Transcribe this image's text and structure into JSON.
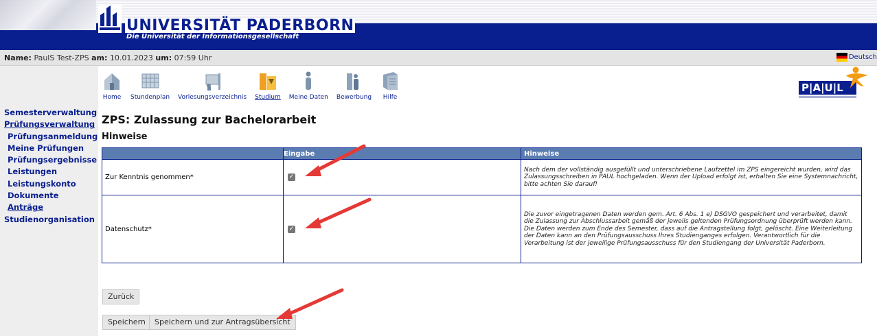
{
  "header": {
    "university": "UNIVERSITÄT PADERBORN",
    "subtitle": "Die Universität der Informationsgesellschaft"
  },
  "infobar": {
    "name_label": "Name:",
    "name_value": "PaulS Test-ZPS",
    "date_label": "am:",
    "date_value": "10.01.2023",
    "time_label": "um:",
    "time_value": "07:59 Uhr",
    "language": "Deutsch"
  },
  "topnav": [
    {
      "label": "Home",
      "icon": "home-icon"
    },
    {
      "label": "Stundenplan",
      "icon": "calendar-icon"
    },
    {
      "label": "Vorlesungsverzeichnis",
      "icon": "lecture-icon"
    },
    {
      "label": "Studium",
      "icon": "study-icon",
      "active": true
    },
    {
      "label": "Meine Daten",
      "icon": "person-icon"
    },
    {
      "label": "Bewerbung",
      "icon": "application-icon"
    },
    {
      "label": "Hilfe",
      "icon": "help-icon"
    }
  ],
  "paul_logo": "P|A|U|L",
  "leftnav": [
    {
      "label": "Semesterverwaltung"
    },
    {
      "label": "Prüfungsverwaltung"
    },
    {
      "label": "Prüfungsanmeldung"
    },
    {
      "label": "Meine Prüfungen"
    },
    {
      "label": "Prüfungsergebnisse"
    },
    {
      "label": "Leistungen"
    },
    {
      "label": "Leistungskonto"
    },
    {
      "label": "Dokumente"
    },
    {
      "label": "Anträge"
    },
    {
      "label": "Studienorganisation"
    }
  ],
  "page_title": "ZPS: Zulassung zur Bachelorarbeit",
  "section_title": "Hinweise",
  "table": {
    "headers": [
      "",
      "Eingabe",
      "Hinweise"
    ],
    "rows": [
      {
        "label": "Zur Kenntnis genommen*",
        "checked": true,
        "hint": "Nach dem der vollständig ausgefüllt und unterschriebene Laufzettel im ZPS eingereicht wurden, wird das Zulassungsschreiben in PAUL hochgeladen. Wenn der Upload erfolgt ist, erhalten Sie eine Systemnachricht, bitte achten Sie darauf!"
      },
      {
        "label": "Datenschutz*",
        "checked": true,
        "hint": "Die zuvor eingetragenen Daten werden gem. Art. 6 Abs. 1 e) DSGVO gespeichert und verarbeitet, damit die Zulassung zur Abschlussarbeit gemäß der jeweils geltenden Prüfungsordnung überprüft werden kann. Die Daten werden zum Ende des Semester, dass auf die Antragstellung folgt, gelöscht. Eine Weiterleitung der Daten kann an den Prüfungsausschuss Ihres Studienganges erfolgen. Verantwortlich für die Verarbeitung ist der jeweilige Prüfungsausschuss für den Studiengang der Universität Paderborn."
      }
    ]
  },
  "buttons": {
    "back": "Zurück",
    "save": "Speichern",
    "save_overview": "Speichern und zur Antragsübersicht"
  },
  "colors": {
    "brand_blue": "#0a1f8f",
    "table_header": "#5a7cb0",
    "annotation_arrow": "#e53935"
  }
}
